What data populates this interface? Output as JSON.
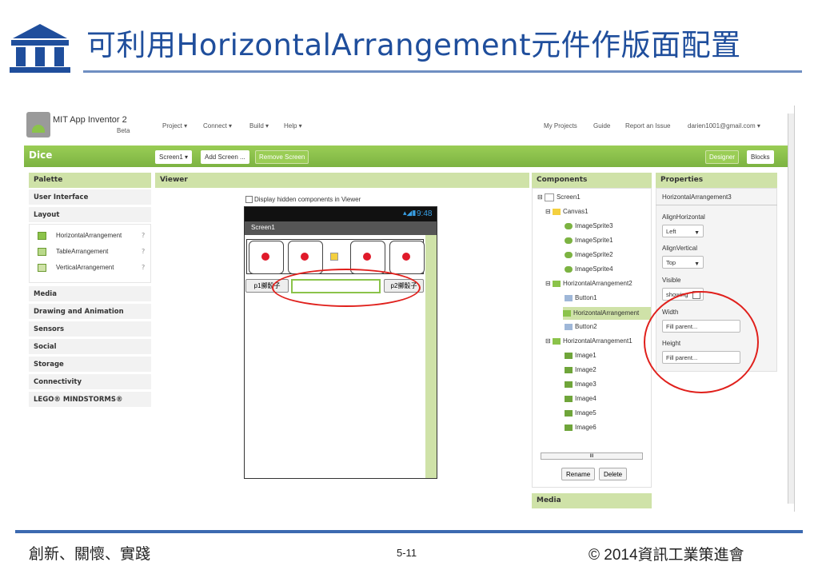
{
  "slide": {
    "title": "可利用HorizontalArrangement元件作版面配置",
    "footer_left": "創新、關懷、實踐",
    "page_number": "5-11",
    "footer_right": "© 2014資訊工業策進會"
  },
  "app": {
    "brand": "MIT App Inventor 2",
    "brand_sub": "Beta",
    "menu": [
      "Project ▾",
      "Connect ▾",
      "Build ▾",
      "Help ▾"
    ],
    "right_links": [
      "My Projects",
      "Guide",
      "Report an Issue"
    ],
    "user": "darien1001@gmail.com ▾",
    "project_name": "Dice",
    "screen_select": "Screen1 ▾",
    "add_screen": "Add Screen ...",
    "remove_screen": "Remove Screen",
    "designer": "Designer",
    "blocks": "Blocks"
  },
  "palette": {
    "header": "Palette",
    "categories_top": [
      "User Interface",
      "Layout"
    ],
    "layout_items": [
      "HorizontalArrangement",
      "TableArrangement",
      "VerticalArrangement"
    ],
    "help_mark": "?",
    "categories_bottom": [
      "Media",
      "Drawing and Animation",
      "Sensors",
      "Social",
      "Storage",
      "Connectivity",
      "LEGO® MINDSTORMS®"
    ]
  },
  "viewer": {
    "header": "Viewer",
    "hidden_checkbox": "Display hidden components in Viewer",
    "status_time": "9:48",
    "screen_title": "Screen1",
    "left_button": "p1擲骰子",
    "right_button": "p2擲骰子"
  },
  "components": {
    "header": "Components",
    "tree": [
      {
        "label": "Screen1",
        "depth": 0,
        "toggle": "⊟"
      },
      {
        "label": "Canvas1",
        "depth": 1,
        "toggle": "⊟"
      },
      {
        "label": "ImageSprite3",
        "depth": 2
      },
      {
        "label": "ImageSprite1",
        "depth": 2
      },
      {
        "label": "ImageSprite2",
        "depth": 2
      },
      {
        "label": "ImageSprite4",
        "depth": 2
      },
      {
        "label": "HorizontalArrangement2",
        "depth": 1,
        "toggle": "⊟"
      },
      {
        "label": "Button1",
        "depth": 2
      },
      {
        "label": "HorizontalArrangement",
        "depth": 2,
        "selected": true
      },
      {
        "label": "Button2",
        "depth": 2
      },
      {
        "label": "HorizontalArrangement1",
        "depth": 1,
        "toggle": "⊟"
      },
      {
        "label": "Image1",
        "depth": 2
      },
      {
        "label": "Image2",
        "depth": 2
      },
      {
        "label": "Image3",
        "depth": 2
      },
      {
        "label": "Image4",
        "depth": 2
      },
      {
        "label": "Image5",
        "depth": 2
      },
      {
        "label": "Image6",
        "depth": 2
      }
    ],
    "scroll_mid": "III",
    "rename": "Rename",
    "delete": "Delete",
    "media_header": "Media"
  },
  "properties": {
    "header": "Properties",
    "component": "HorizontalArrangement3",
    "align_h_label": "AlignHorizontal",
    "align_h_value": "Left",
    "align_v_label": "AlignVertical",
    "align_v_value": "Top",
    "visible_label": "Visible",
    "visible_value": "showing",
    "width_label": "Width",
    "width_value": "Fill parent...",
    "height_label": "Height",
    "height_value": "Fill parent..."
  },
  "colors": {
    "accent_green": "#8bc34a",
    "title_blue": "#1f4e9c",
    "annotation_red": "#e0201c"
  }
}
